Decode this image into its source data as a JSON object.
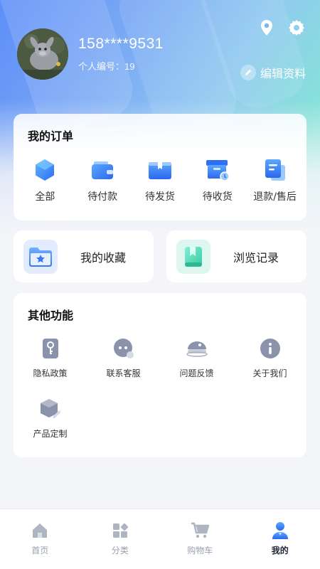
{
  "profile": {
    "phone": "158****9531",
    "member_id_label": "个人编号：",
    "member_id": "19",
    "edit_label": "编辑资料"
  },
  "header_icons": [
    "location-icon",
    "settings-icon"
  ],
  "orders": {
    "title": "我的订单",
    "items": [
      {
        "label": "全部",
        "icon": "all-orders-icon"
      },
      {
        "label": "待付款",
        "icon": "wallet-icon"
      },
      {
        "label": "待发货",
        "icon": "box-open-icon"
      },
      {
        "label": "待收货",
        "icon": "delivery-box-icon"
      },
      {
        "label": "退款/售后",
        "icon": "refund-doc-icon"
      }
    ]
  },
  "favorites": {
    "label": "我的收藏",
    "icon": "star-folder-icon"
  },
  "history": {
    "label": "浏览记录",
    "icon": "bookmark-book-icon"
  },
  "other": {
    "title": "其他功能",
    "items": [
      {
        "label": "隐私政策",
        "icon": "key-icon"
      },
      {
        "label": "联系客服",
        "icon": "chat-icon"
      },
      {
        "label": "问题反馈",
        "icon": "feedback-icon"
      },
      {
        "label": "关于我们",
        "icon": "info-icon"
      },
      {
        "label": "产品定制",
        "icon": "cube-edit-icon"
      }
    ]
  },
  "tabbar": {
    "active": "我的",
    "items": [
      {
        "label": "首页",
        "icon": "home-icon"
      },
      {
        "label": "分类",
        "icon": "category-icon"
      },
      {
        "label": "购物车",
        "icon": "cart-icon"
      },
      {
        "label": "我的",
        "icon": "user-icon"
      }
    ]
  },
  "colors": {
    "accent": "#3d7cf3",
    "tab_inactive": "#9aa0ad",
    "icon_gray": "#8a93a8"
  }
}
